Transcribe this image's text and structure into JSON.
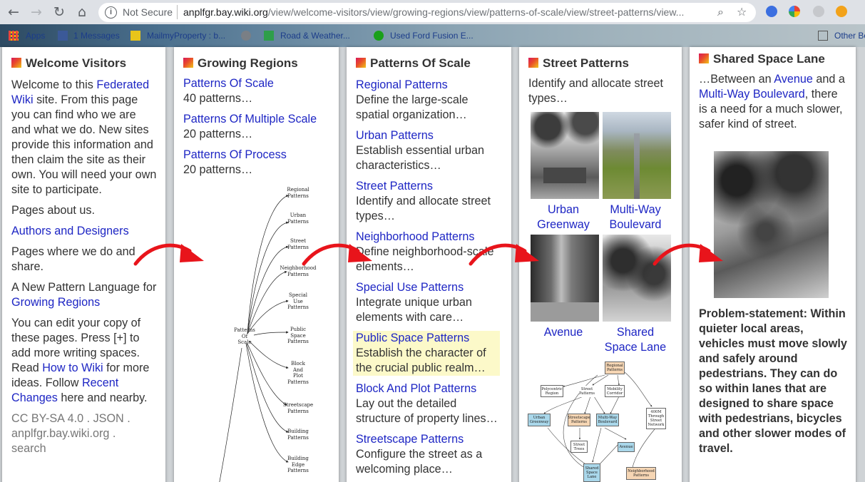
{
  "browser": {
    "security_label": "Not Secure",
    "url_host": "anplfgr.bay.wiki.org",
    "url_path": "/view/welcome-visitors/view/growing-regions/view/patterns-of-scale/view/street-patterns/view..."
  },
  "bookmarks": [
    {
      "label": "Apps"
    },
    {
      "label": "1 Messages"
    },
    {
      "label": "MailmyProperty : b..."
    },
    {
      "label": "Road & Weather..."
    },
    {
      "label": "Used Ford Fusion E..."
    },
    {
      "label": "Other Bo"
    }
  ],
  "pages": {
    "welcome": {
      "title": "Welcome Visitors",
      "p1_a": "Welcome to this",
      "p1_link": "Federated Wiki",
      "p1_b": "site. From this page you can find who we are and what we do. New sites provide this information and then claim the site as their own. You will need your own site to participate.",
      "p2": "Pages about us.",
      "p3_link": "Authors and Designers",
      "p4": "Pages where we do and share.",
      "p5_a": "A New Pattern Language for",
      "p5_link": "Growing Regions",
      "p6_a": "You can edit your copy of these pages. Press [+] to add more writing spaces. Read",
      "p6_link1": "How to Wiki",
      "p6_b": "for more ideas. Follow",
      "p6_link2": "Recent Changes",
      "p6_c": "here and nearby.",
      "footer_a": "CC BY-SA 4.0 . JSON .",
      "footer_b": "anplfgr.bay.wiki.org .",
      "footer_c": "search"
    },
    "growing": {
      "title": "Growing Regions",
      "items": [
        {
          "link": "Patterns Of Scale",
          "desc": "40 patterns…"
        },
        {
          "link": "Patterns Of Multiple Scale",
          "desc": "20 patterns…"
        },
        {
          "link": "Patterns Of Process",
          "desc": "20 patterns…"
        }
      ],
      "diagram": {
        "root": [
          "Patterns",
          "Of",
          "Scale"
        ],
        "nodes": [
          [
            "Regional",
            "Patterns"
          ],
          [
            "Urban",
            "Patterns"
          ],
          [
            "Street",
            "Patterns"
          ],
          [
            "Neighborhood",
            "Patterns"
          ],
          [
            "Special",
            "Use",
            "Patterns"
          ],
          [
            "Public",
            "Space",
            "Patterns"
          ],
          [
            "Block",
            "And",
            "Plot",
            "Patterns"
          ],
          [
            "Streetscape",
            "Patterns"
          ],
          [
            "Building",
            "Patterns"
          ],
          [
            "Building",
            "Edge",
            "Patterns"
          ]
        ]
      }
    },
    "scale": {
      "title": "Patterns Of Scale",
      "items": [
        {
          "link": "Regional Patterns",
          "desc": "Define the large-scale spatial organization…"
        },
        {
          "link": "Urban Patterns",
          "desc": "Establish essential urban characteristics…"
        },
        {
          "link": "Street Patterns",
          "desc": "Identify and allocate street types…"
        },
        {
          "link": "Neighborhood Patterns",
          "desc": "Define neighborhood-scale elements…"
        },
        {
          "link": "Special Use Patterns",
          "desc": "Integrate unique urban elements with care…"
        },
        {
          "link": "Public Space Patterns",
          "desc": "Establish the character of the crucial public realm…"
        },
        {
          "link": "Block And Plot Patterns",
          "desc": "Lay out the detailed structure of property lines…"
        },
        {
          "link": "Streetscape Patterns",
          "desc": "Configure the street as a welcoming place…"
        }
      ]
    },
    "street": {
      "title": "Street Patterns",
      "intro": "Identify and allocate street types…",
      "thumbs": [
        {
          "line1": "Urban",
          "line2": "Greenway"
        },
        {
          "line1": "Multi-Way",
          "line2": "Boulevard"
        },
        {
          "line1": "Avenue",
          "line2": ""
        },
        {
          "line1": "Shared",
          "line2": "Space Lane"
        }
      ],
      "graph": {
        "regional": "Regional Patterns",
        "polycentric": "Polycentric Region",
        "street": "Street Patterns",
        "mobility": "Mobility Corridor",
        "urban_greenway": "Urban Greenway",
        "streetscape": "Streetscape Patterns",
        "multiway": "Multi-Way Boulevard",
        "through_network": "400M Through Street Network",
        "street_trees": "Street Trees",
        "avenue": "Avenue",
        "shared_lane": "Shared Space Lane",
        "neighborhood": "Neighborhood Patterns"
      }
    },
    "shared": {
      "title": "Shared Space Lane",
      "p1_a": "…Between an",
      "p1_link1": "Avenue",
      "p1_b": "and a",
      "p1_link2": "Multi-Way Boulevard",
      "p1_c": ", there is a need for a much slower, safer kind of street.",
      "problem": "Problem-statement: Within quieter local areas, vehicles must move slowly and safely around pedestrians. They can do so within lanes that are designed to share space with pedestrians, bicycles and other slower modes of travel."
    }
  }
}
